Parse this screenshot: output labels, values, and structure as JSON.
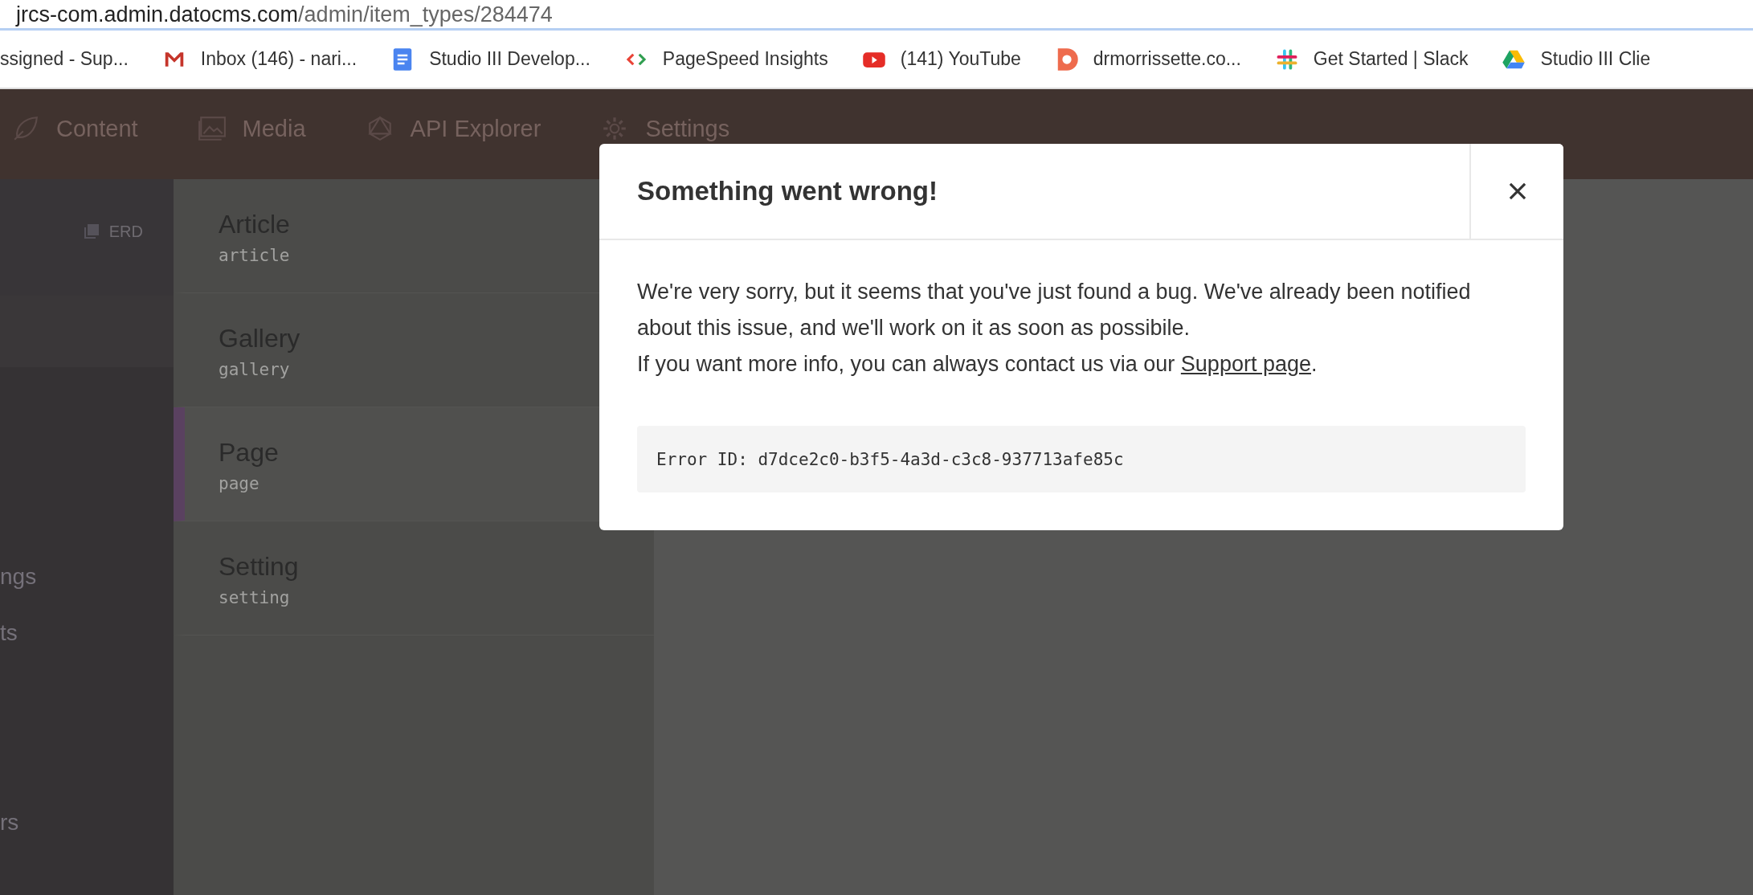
{
  "browser": {
    "url_host": "jrcs-com.admin.datocms.com",
    "url_path": "/admin/item_types/284474",
    "bookmarks": [
      {
        "label": "ssigned - Sup...",
        "kind": "none"
      },
      {
        "label": "Inbox (146) - nari...",
        "kind": "mail"
      },
      {
        "label": "Studio III Develop...",
        "kind": "doc"
      },
      {
        "label": "PageSpeed Insights",
        "kind": "chevrons"
      },
      {
        "label": "(141) YouTube",
        "kind": "play"
      },
      {
        "label": "drmorrissette.co...",
        "kind": "ring"
      },
      {
        "label": "Get Started | Slack",
        "kind": "hash"
      },
      {
        "label": "Studio III Clie",
        "kind": "triangle"
      }
    ]
  },
  "nav": [
    {
      "label": "Content",
      "kind": "leaf"
    },
    {
      "label": "Media",
      "kind": "image"
    },
    {
      "label": "API Explorer",
      "kind": "graph"
    },
    {
      "label": "Settings",
      "kind": "gear"
    }
  ],
  "sidebar": {
    "erd_link": "ERD",
    "items": [
      "ngs",
      "ts",
      "rs"
    ]
  },
  "models": [
    {
      "name": "Article",
      "api_key": "article",
      "selected": false
    },
    {
      "name": "Gallery",
      "api_key": "gallery",
      "selected": false
    },
    {
      "name": "Page",
      "api_key": "page",
      "selected": true
    },
    {
      "name": "Setting",
      "api_key": "setting",
      "selected": false
    }
  ],
  "modal": {
    "title": "Something went wrong!",
    "message": "We're very sorry, but it seems that you've just found a bug. We've already been notified about this issue, and we'll work on it as soon as possibile.",
    "contact_before": "If you want more info, you can always contact us via our ",
    "contact_link": "Support page",
    "contact_after": ".",
    "error_id": "Error ID: d7dce2c0-b3f5-4a3d-c3c8-937713afe85c"
  }
}
